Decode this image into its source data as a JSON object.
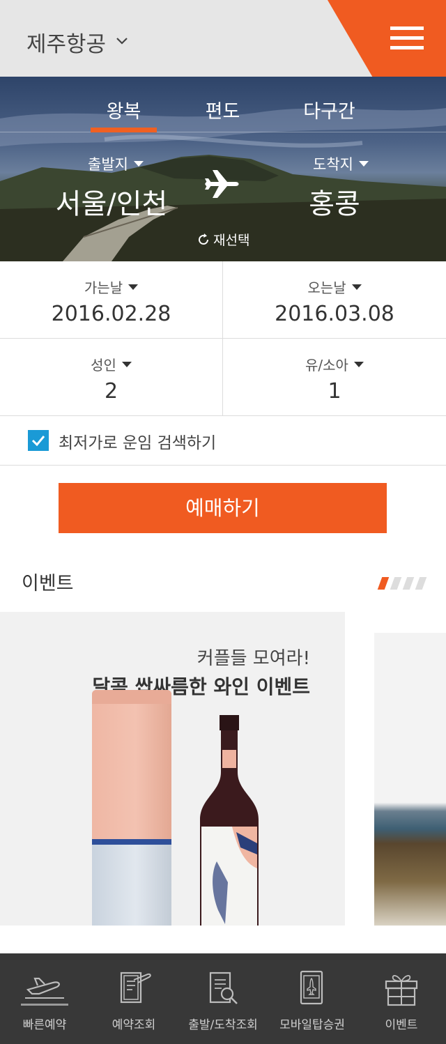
{
  "header": {
    "airline_name": "제주항공",
    "menu_icon": "hamburger-menu-icon",
    "accent_color": "#f05b21"
  },
  "trip_tabs": [
    {
      "label": "왕복",
      "selected": true
    },
    {
      "label": "편도",
      "selected": false
    },
    {
      "label": "다구간",
      "selected": false
    }
  ],
  "route": {
    "departure_label": "출발지",
    "departure_city": "서울/인천",
    "arrival_label": "도착지",
    "arrival_city": "홍콩",
    "reselect_label": "재선택"
  },
  "dates": {
    "depart_label": "가는날",
    "depart_value": "2016.02.28",
    "return_label": "오는날",
    "return_value": "2016.03.08"
  },
  "passengers": {
    "adult_label": "성인",
    "adult_value": "2",
    "child_label": "유/소아",
    "child_value": "1"
  },
  "lowest_fare": {
    "label": "최저가로 운임 검색하기",
    "checked": true
  },
  "book_button": "예매하기",
  "events": {
    "title": "이벤트",
    "page_count": 4,
    "current_page": 1,
    "card": {
      "subtitle": "커플들 모여라!",
      "title": "달콤 쌉싸름한 와인 이벤트"
    }
  },
  "bottom_nav": [
    {
      "label": "빠른예약",
      "icon": "airplane-takeoff-icon",
      "active": true
    },
    {
      "label": "예약조회",
      "icon": "booking-document-icon",
      "active": false
    },
    {
      "label": "출발/도착조회",
      "icon": "flight-status-search-icon",
      "active": false
    },
    {
      "label": "모바일탑승권",
      "icon": "mobile-boarding-pass-icon",
      "active": false
    },
    {
      "label": "이벤트",
      "icon": "gift-icon",
      "active": false
    }
  ]
}
